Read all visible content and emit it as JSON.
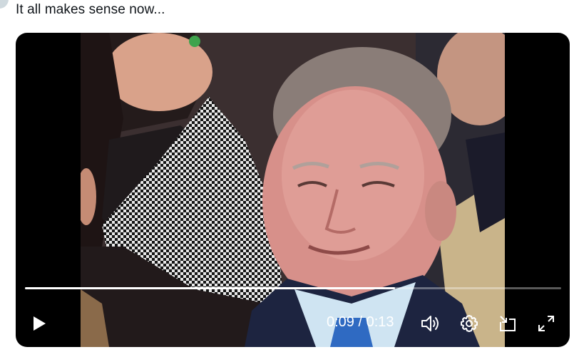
{
  "post": {
    "text": "It all makes sense now..."
  },
  "video": {
    "progress": 0.69,
    "time_current": "0:09",
    "time_separator": "/",
    "time_total": "0:13",
    "time_display": "0:09 / 0:13",
    "controls": {
      "play_icon": "play-icon",
      "volume_icon": "volume-icon",
      "settings_icon": "gear-icon",
      "pip_icon": "picture-in-picture-icon",
      "fullscreen_icon": "expand-icon"
    }
  }
}
